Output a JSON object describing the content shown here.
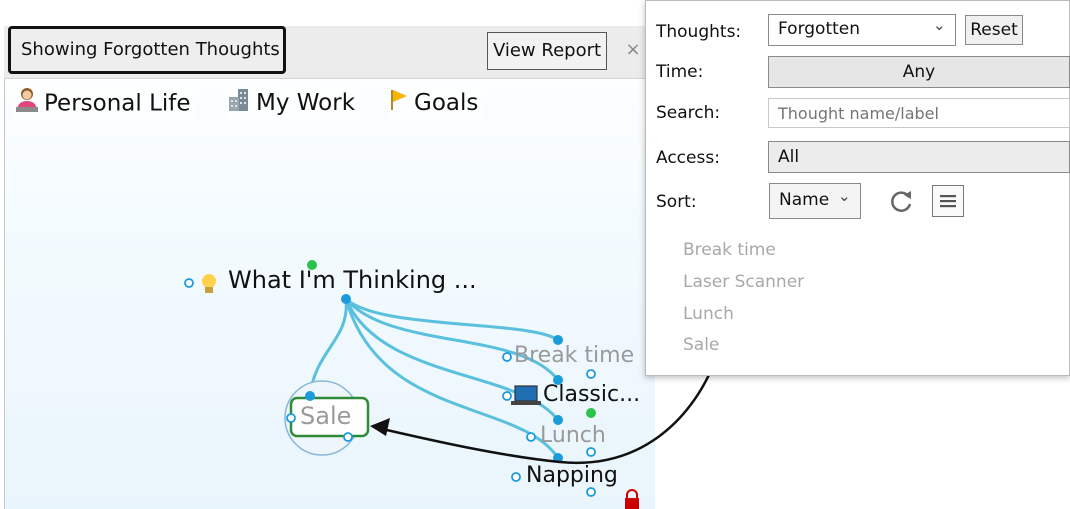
{
  "header": {
    "title": "Showing Forgotten Thoughts",
    "view_report_label": "View Report",
    "close_glyph": "×"
  },
  "pins": [
    {
      "label": "Personal Life",
      "icon": "person-icon"
    },
    {
      "label": "My Work",
      "icon": "building-icon"
    },
    {
      "label": "Goals",
      "icon": "flag-icon"
    }
  ],
  "brain": {
    "central": "What I'm Thinking ...",
    "children": [
      "Break time",
      "Classic...",
      "Lunch",
      "Napping",
      "Sale"
    ]
  },
  "report": {
    "labels": {
      "thoughts": "Thoughts:",
      "time": "Time:",
      "search": "Search:",
      "access": "Access:",
      "sort": "Sort:"
    },
    "thoughts_value": "Forgotten",
    "reset_label": "Reset",
    "time_value": "Any",
    "search_placeholder": "Thought name/label",
    "access_value": "All",
    "sort_value": "Name",
    "dropdown_glyph": "⌄",
    "results": [
      "Break time",
      "Laser Scanner",
      "Lunch",
      "Sale"
    ]
  },
  "colors": {
    "link": "#5bc0de",
    "node_dot": "#1b9bdc",
    "active_dot": "#2cc34a",
    "highlight": "#2e8b3a",
    "lock": "#cc0000"
  }
}
